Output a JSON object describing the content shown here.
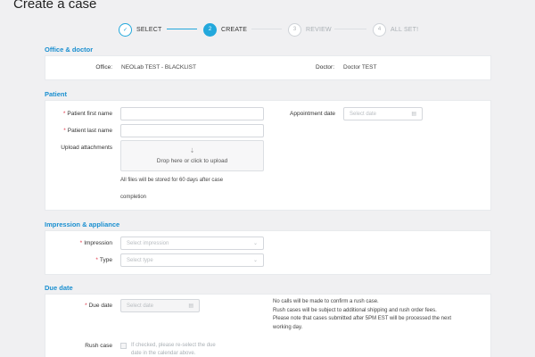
{
  "page": {
    "title": "Create a case"
  },
  "stepper": {
    "steps": [
      {
        "number": "✓",
        "label": "SELECT"
      },
      {
        "number": "2",
        "label": "CREATE"
      },
      {
        "number": "3",
        "label": "REVIEW"
      },
      {
        "number": "4",
        "label": "ALL SET!"
      }
    ]
  },
  "office": {
    "title": "Office & doctor",
    "office_label": "Office:",
    "office_value": "NEOLab TEST - BLACKLIST",
    "doctor_label": "Doctor:",
    "doctor_value": "Doctor TEST"
  },
  "patient": {
    "title": "Patient",
    "first_name_label": "Patient first name",
    "last_name_label": "Patient last name",
    "upload_label": "Upload attachments",
    "upload_text": "Drop here or click to upload",
    "upload_note_1": "All files will be stored for 60 days after case",
    "upload_note_2": "completion",
    "appointment_label": "Appointment date",
    "appointment_placeholder": "Select date"
  },
  "impression": {
    "title": "Impression & appliance",
    "impression_label": "Impression",
    "impression_placeholder": "Select impression",
    "type_label": "Type",
    "type_placeholder": "Select type"
  },
  "due": {
    "title": "Due date",
    "due_label": "Due date",
    "due_placeholder": "Select date",
    "rush_label": "Rush case",
    "rush_note_1": "If checked, please re-select the due",
    "rush_note_2": "date in the calendar above.",
    "notice_1": "No calls will be made to confirm a rush case.",
    "notice_2": "Rush cases will be subject to additional shipping and rush order fees.",
    "notice_3": "Please note that cases submitted after 5PM EST will be processed the next",
    "notice_4": "working day."
  },
  "required_mark": "*",
  "icons": {
    "calendar": "calendar-icon",
    "chevron": "chevron-down-icon",
    "upload": "upload-icon"
  },
  "colors": {
    "accent": "#23a8dc",
    "section_title": "#1a8fd0",
    "required": "#e0384a"
  }
}
